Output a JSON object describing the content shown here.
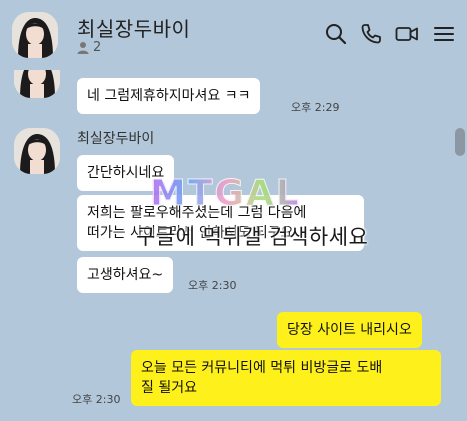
{
  "header": {
    "title": "최실장두바이",
    "member_count": "2",
    "icons": [
      "search-icon",
      "phone-icon",
      "video-call-icon",
      "menu-icon"
    ]
  },
  "messages": {
    "first": {
      "text": "네 그럼제휴하지마셔요 ㅋㅋ",
      "time": "오후 2:29"
    },
    "group": {
      "sender": "최실장두바이",
      "bubble1": "간단하시네요",
      "bubble2_line1": "저희는 팔로우해주셨는데 그럼 다음에",
      "bubble2_line2": "떠가는 사이트라서 안하셔도 되구요",
      "bubble3": "고생하셔요~",
      "time": "오후 2:30"
    },
    "mine": {
      "bubble1": "당장 사이트 내리시오",
      "bubble2_line1": "오늘 모든 커뮤니티에 먹튀 비방글로 도배",
      "bubble2_line2": "질 될거요",
      "time": "오후 2:30"
    }
  },
  "watermark": {
    "logo": "MTGAL",
    "caption": "구글에 먹튀갤 검색하세요"
  },
  "colors": {
    "background": "#b2c7da",
    "my_bubble": "#fef01b",
    "their_bubble": "#ffffff"
  }
}
